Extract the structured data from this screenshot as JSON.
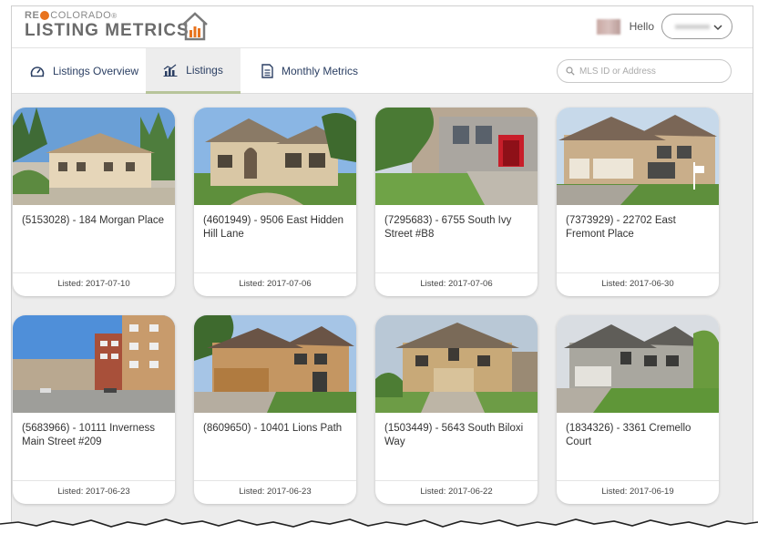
{
  "brand": {
    "top_small": "RE",
    "top_small_rest": "COLORADO",
    "reg_mark": "®",
    "name": "LISTING METRICS"
  },
  "user": {
    "greeting": "Hello"
  },
  "tabs": [
    {
      "label": "Listings Overview",
      "icon": "speedometer-icon",
      "active": false
    },
    {
      "label": "Listings",
      "icon": "bar-chart-icon",
      "active": true
    },
    {
      "label": "Monthly Metrics",
      "icon": "document-icon",
      "active": false
    }
  ],
  "search": {
    "placeholder": "MLS ID or Address"
  },
  "listings": [
    {
      "title": "(5153028) - 184 Morgan Place",
      "listed": "Listed: 2017-07-10"
    },
    {
      "title": "(4601949) - 9506 East Hidden Hill Lane",
      "listed": "Listed: 2017-07-06"
    },
    {
      "title": "(7295683) - 6755 South Ivy Street #B8",
      "listed": "Listed: 2017-07-06"
    },
    {
      "title": "(7373929) - 22702 East Fremont Place",
      "listed": "Listed: 2017-06-30"
    },
    {
      "title": "(5683966) - 10111 Inverness Main Street #209",
      "listed": "Listed: 2017-06-23"
    },
    {
      "title": "(8609650) - 10401 Lions Path",
      "listed": "Listed: 2017-06-23"
    },
    {
      "title": "(1503449) - 5643 South Biloxi Way",
      "listed": "Listed: 2017-06-22"
    },
    {
      "title": "(1834326) - 3361 Cremello Court",
      "listed": "Listed: 2017-06-19"
    }
  ],
  "colors": {
    "accent_orange": "#e8731e",
    "nav_text": "#2b3f63",
    "active_tab_underline": "#b7c49a",
    "content_bg": "#ececec"
  }
}
